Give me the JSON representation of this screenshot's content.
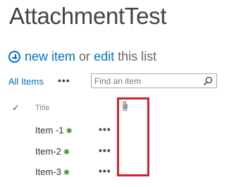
{
  "page": {
    "title": "AttachmentTest"
  },
  "command": {
    "new_item": "new item",
    "or": "or",
    "edit": "edit",
    "this_list": "this list"
  },
  "views": {
    "current": "All Items",
    "more": "•••"
  },
  "search": {
    "placeholder": "Find an item",
    "value": ""
  },
  "list": {
    "header": {
      "title": "Title"
    },
    "items": [
      {
        "title": "Item -1",
        "new_badge": "✱",
        "more": "•••"
      },
      {
        "title": "Item-2",
        "new_badge": "✱",
        "more": "•••"
      },
      {
        "title": "Item-3",
        "new_badge": "✱",
        "more": "•••"
      }
    ]
  },
  "colors": {
    "link": "#0072c6",
    "highlight": "#d0232f",
    "new_badge": "#4c8c2b"
  }
}
